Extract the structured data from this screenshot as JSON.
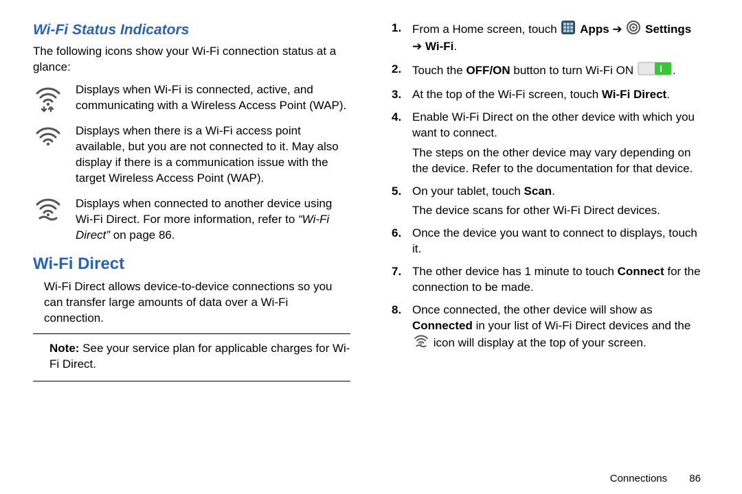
{
  "left": {
    "h_status": "Wi-Fi Status Indicators",
    "intro": "The following icons show your Wi-Fi connection status at a glance:",
    "ind1": "Displays when Wi-Fi is connected, active, and communicating with a Wireless Access Point (WAP).",
    "ind2": "Displays when there is a Wi-Fi access point available, but you are not connected to it. May also display if there is a communication issue with the target Wireless Access Point (WAP).",
    "ind3_a": "Displays when connected to another device using Wi-Fi Direct. For more information, refer to ",
    "ind3_b": "“Wi-Fi Direct”",
    "ind3_c": "  on page 86.",
    "h_direct": "Wi-Fi Direct",
    "direct_p": "Wi-Fi Direct allows device-to-device connections so you can transfer large amounts of data over a Wi-Fi connection.",
    "note_label": "Note: ",
    "note_text": "See your service plan for applicable charges for Wi-Fi Direct."
  },
  "right": {
    "s1a": "From a Home screen, touch ",
    "s1_apps": " Apps ",
    "s1_settings": " Settings ",
    "s1_wifi": " Wi-Fi",
    "s2a": "Touch the ",
    "s2b": "OFF/ON",
    "s2c": " button to turn Wi-Fi ON ",
    "s2d": ".",
    "s3a": "At the top of the Wi-Fi screen, touch ",
    "s3b": "Wi-Fi Direct",
    "s3c": ".",
    "s4": "Enable Wi-Fi Direct on the other device with which you want to connect.",
    "s4b": "The steps on the other device may vary depending on the device. Refer to the documentation for that device.",
    "s5a": "On your tablet, touch ",
    "s5b": "Scan",
    "s5c": ".",
    "s5d": "The device scans for other Wi-Fi Direct devices.",
    "s6": "Once the device you want to connect to displays, touch it.",
    "s7a": "The other device has 1 minute to touch ",
    "s7b": "Connect",
    "s7c": " for the connection to be made.",
    "s8a": "Once connected, the other device will show as ",
    "s8b": "Connected",
    "s8c": " in your list of Wi-Fi Direct devices and the ",
    "s8d": " icon will display at the top of your screen."
  },
  "footer": {
    "section": "Connections",
    "page": "86"
  },
  "arrow": "➔"
}
